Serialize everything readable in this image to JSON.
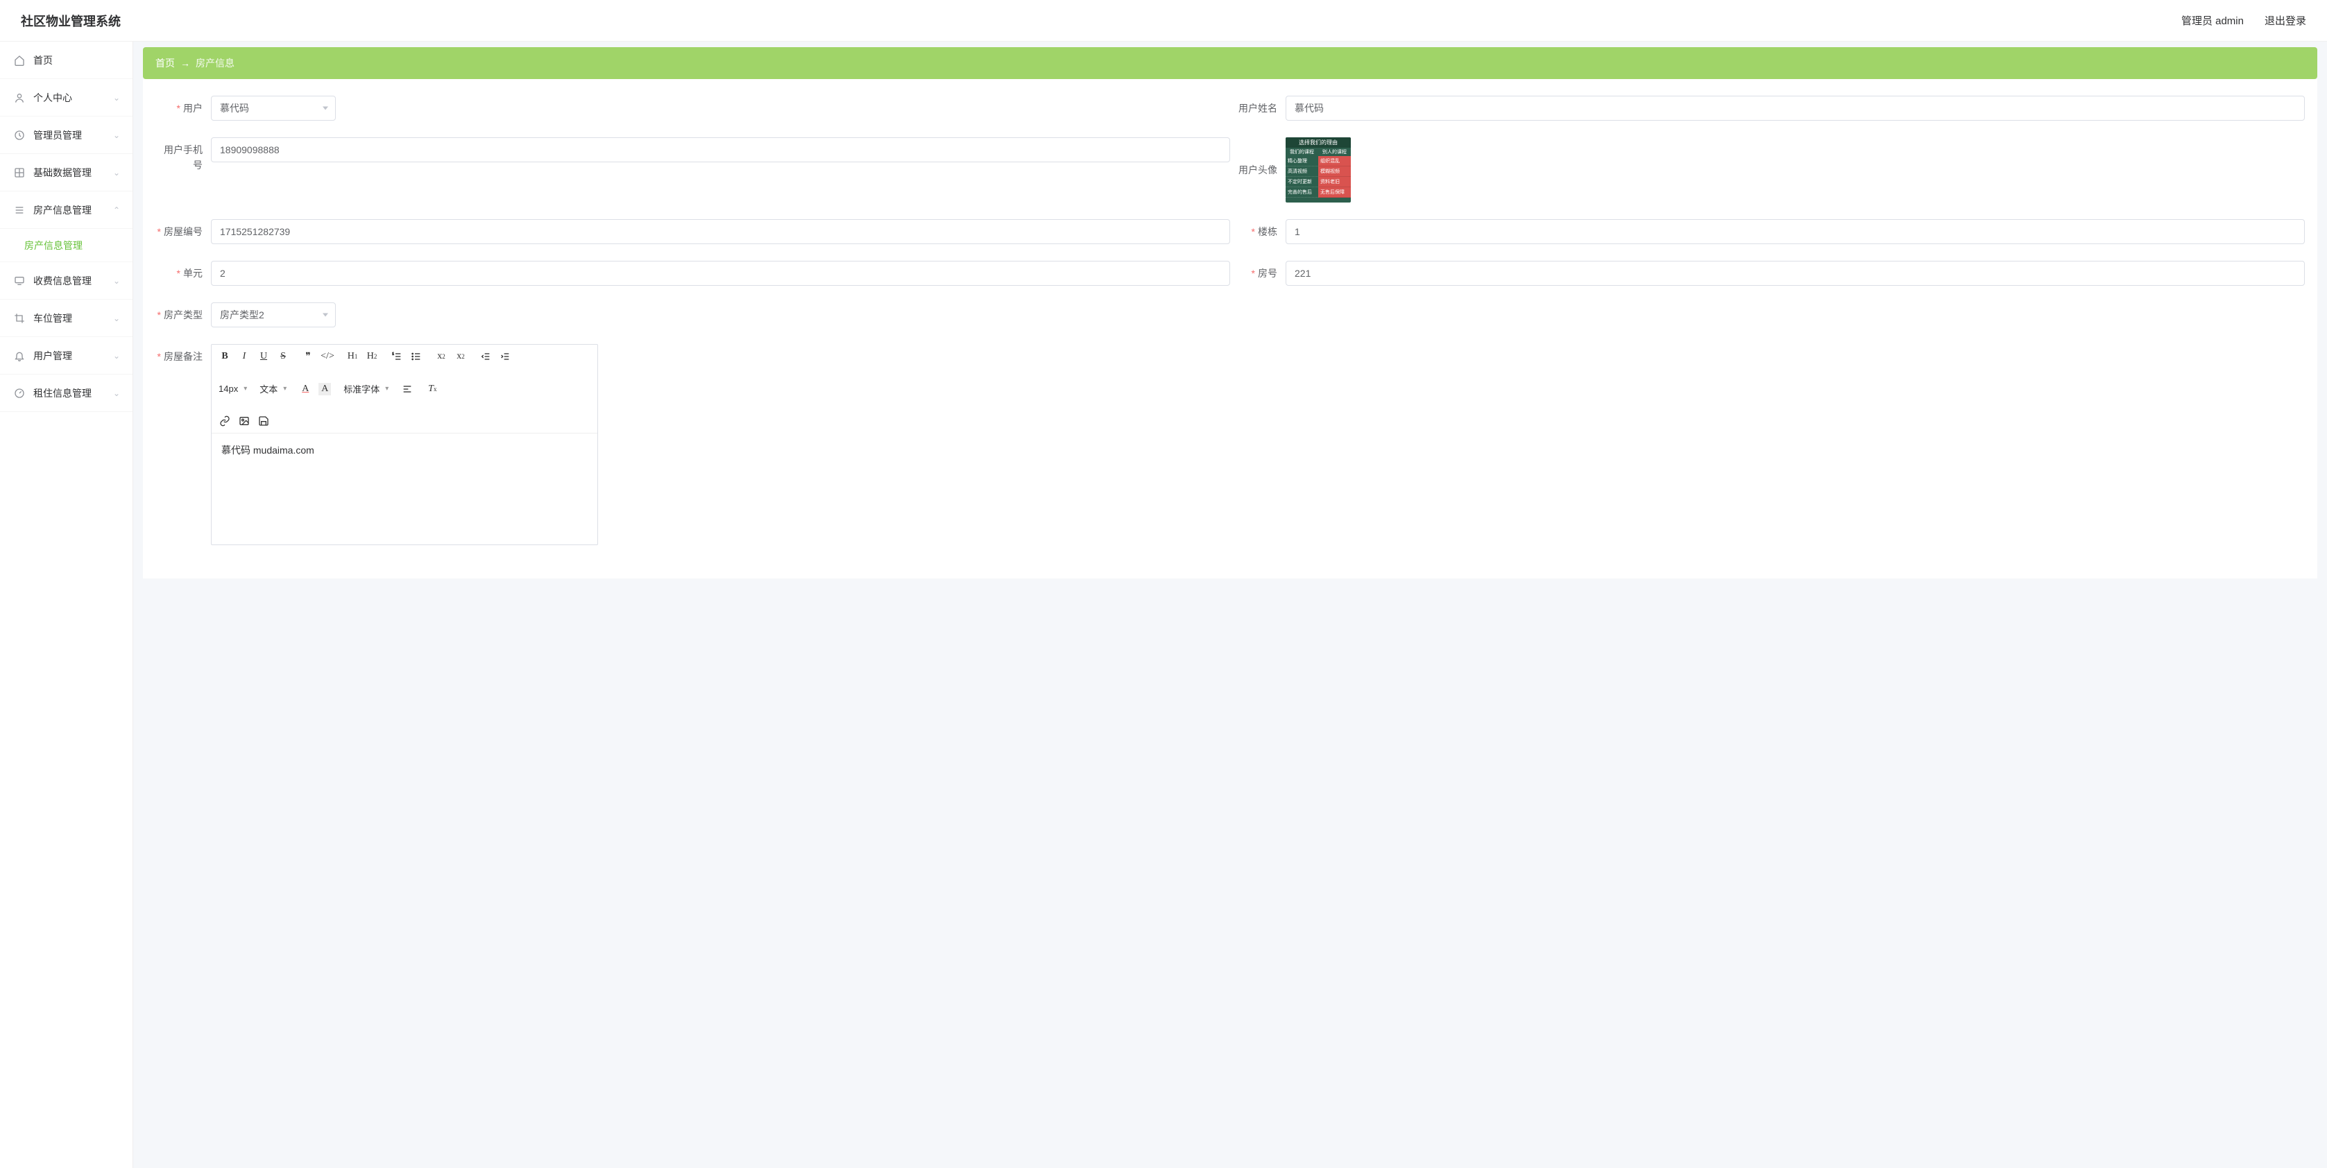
{
  "app": {
    "title": "社区物业管理系统"
  },
  "header": {
    "admin": "管理员 admin",
    "logout": "退出登录"
  },
  "sidebar": {
    "items": [
      {
        "label": "首页",
        "icon": "home",
        "expandable": false
      },
      {
        "label": "个人中心",
        "icon": "user",
        "expandable": true
      },
      {
        "label": "管理员管理",
        "icon": "clock",
        "expandable": true
      },
      {
        "label": "基础数据管理",
        "icon": "grid",
        "expandable": true
      },
      {
        "label": "房产信息管理",
        "icon": "list",
        "expandable": true,
        "open": true,
        "children": [
          {
            "label": "房产信息管理"
          }
        ]
      },
      {
        "label": "收费信息管理",
        "icon": "monitor",
        "expandable": true
      },
      {
        "label": "车位管理",
        "icon": "crop",
        "expandable": true
      },
      {
        "label": "用户管理",
        "icon": "bell",
        "expandable": true
      },
      {
        "label": "租住信息管理",
        "icon": "dashboard",
        "expandable": true
      }
    ]
  },
  "breadcrumb": {
    "home": "首页",
    "current": "房产信息"
  },
  "form": {
    "user_label": "用户",
    "user_value": "慕代码",
    "username_label": "用户姓名",
    "username_value": "慕代码",
    "phone_label": "用户手机号",
    "phone_value": "18909098888",
    "avatar_label": "用户头像",
    "house_no_label": "房屋编号",
    "house_no_value": "1715251282739",
    "building_label": "楼栋",
    "building_value": "1",
    "unit_label": "单元",
    "unit_value": "2",
    "room_label": "房号",
    "room_value": "221",
    "type_label": "房产类型",
    "type_value": "房产类型2",
    "remark_label": "房屋备注",
    "remark_value": "慕代码 mudaima.com"
  },
  "editor_toolbar": {
    "size": "14px",
    "block": "文本",
    "font": "标准字体"
  },
  "avatar_card": {
    "title": "选择我们的理由",
    "col_l": "我们的课程",
    "col_r": "别人的课程",
    "rows": [
      {
        "l": "精心整理",
        "r": "组织混乱"
      },
      {
        "l": "高清视频",
        "r": "模糊视频"
      },
      {
        "l": "不定时更新",
        "r": "资料老旧"
      },
      {
        "l": "完善的售后",
        "r": "无售后保障"
      }
    ]
  }
}
